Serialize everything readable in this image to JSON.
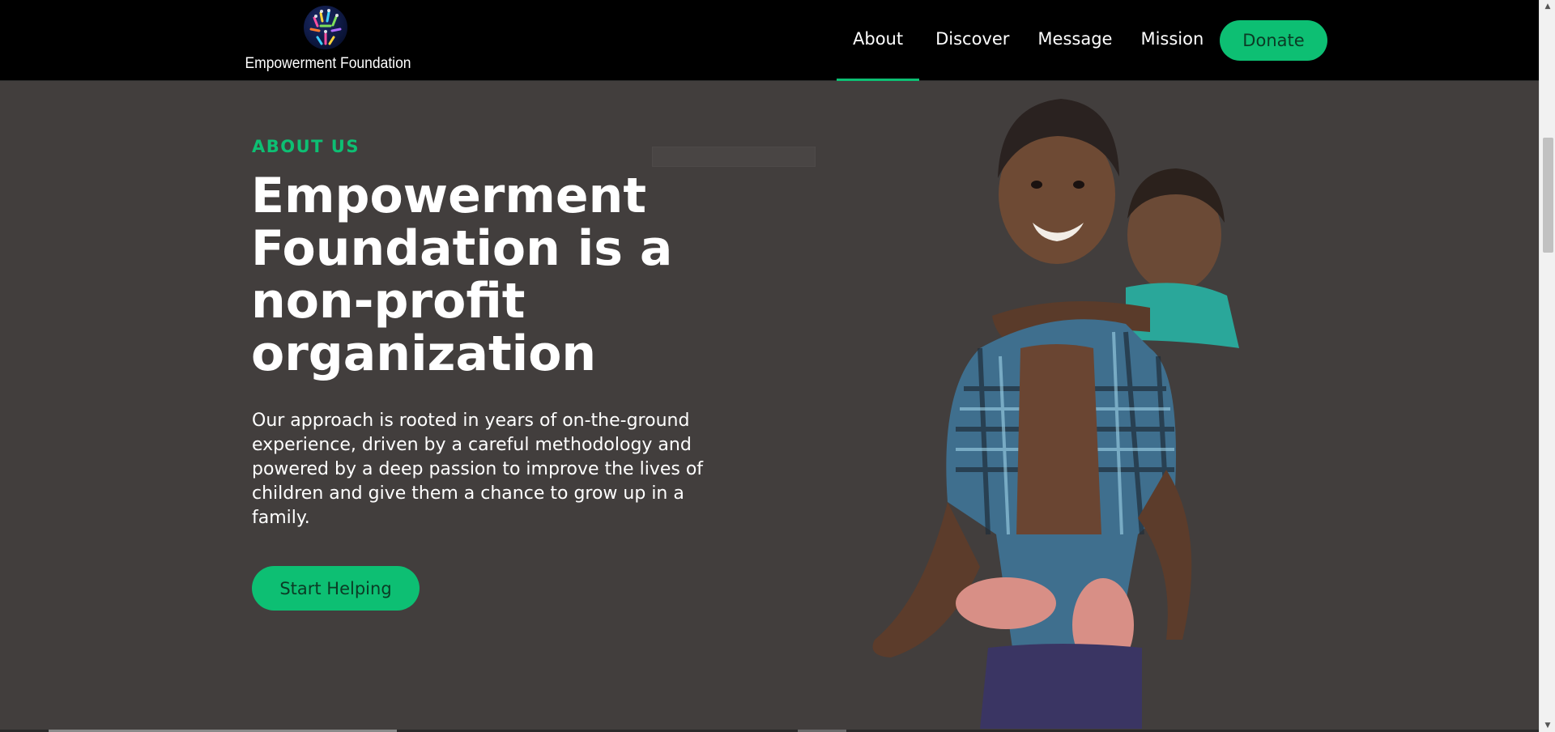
{
  "brand": {
    "name": "Empowerment Foundation"
  },
  "nav": {
    "items": [
      {
        "label": "About"
      },
      {
        "label": "Discover"
      },
      {
        "label": "Message"
      },
      {
        "label": "Mission"
      }
    ],
    "active": "About",
    "donate_label": "Donate"
  },
  "hero": {
    "eyebrow": "ABOUT US",
    "title": "Empowerment Foundation is a non-profit organization",
    "body": "Our approach is rooted in years of on-the-ground experience, driven by a careful methodology and powered by a deep passion to improve the lives of children and give them a chance to grow up in a family.",
    "cta_label": "Start Helping"
  },
  "colors": {
    "accent": "#0dbf73",
    "header_bg": "#000000",
    "page_bg": "#423e3d"
  },
  "icons": {
    "logo": "globe-people-logo-icon",
    "scroll_up": "chevron-up-icon",
    "scroll_down": "chevron-down-icon"
  }
}
